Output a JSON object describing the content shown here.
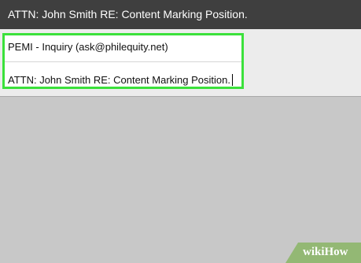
{
  "title_bar": {
    "text": "ATTN: John Smith RE: Content Marking Position."
  },
  "form": {
    "from_field": "PEMI - Inquiry (ask@philequity.net)",
    "subject_field": "ATTN: John Smith RE: Content Marking Position."
  },
  "colors": {
    "highlight": "#3be13b",
    "title_bar": "#3f3f3f",
    "watermark": "#93b874"
  },
  "watermark": {
    "wiki": "wiki",
    "how": "How"
  }
}
